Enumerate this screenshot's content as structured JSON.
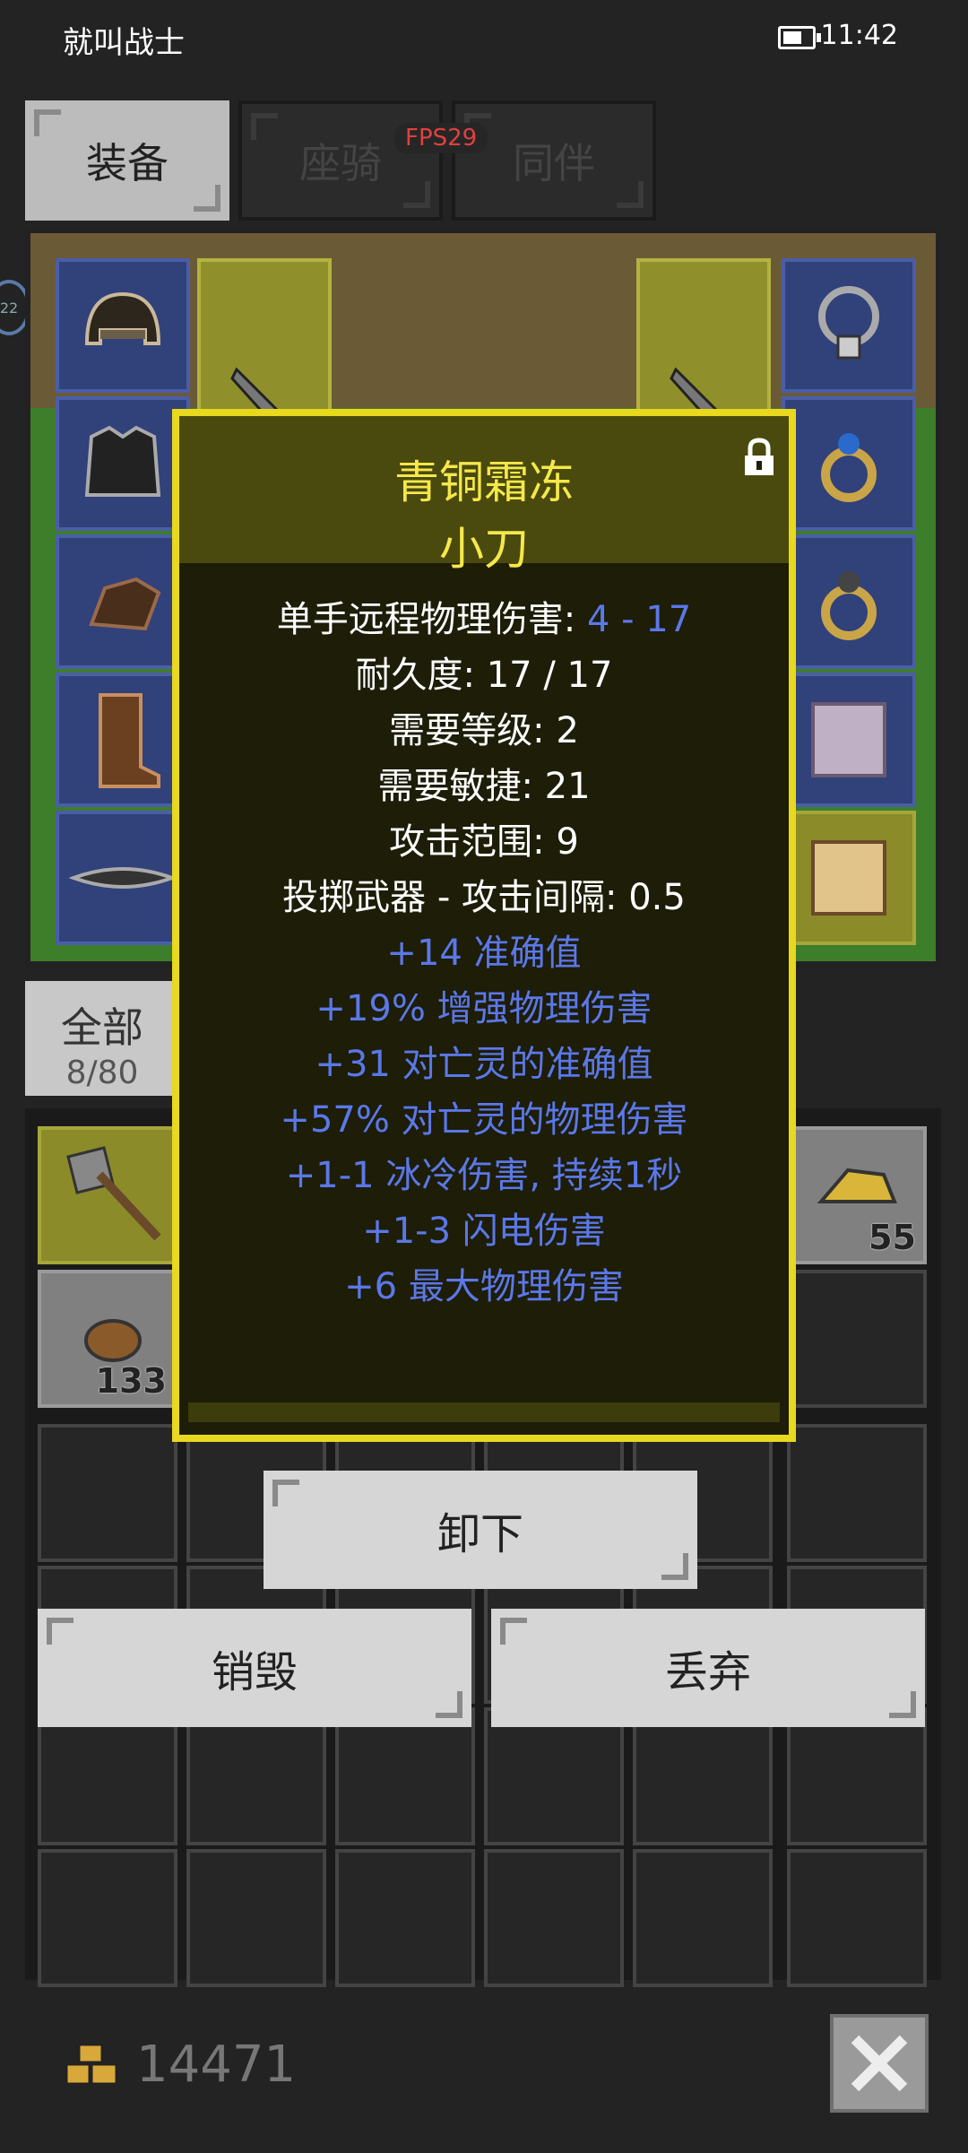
{
  "status_bar": {
    "title": "就叫战士",
    "time": "11:42"
  },
  "tabs": [
    {
      "label": "装备",
      "active": true
    },
    {
      "label": "座骑",
      "active": false
    },
    {
      "label": "同伴",
      "active": false
    }
  ],
  "fps": "FPS29",
  "side_badge": "22",
  "inventory": {
    "filter_label": "全部",
    "capacity": "8/80",
    "stack_counts": {
      "gold_nugget": "55",
      "meat": "133"
    }
  },
  "tooltip": {
    "name_line1": "青铜霜冻",
    "name_line2": "小刀",
    "stats": [
      {
        "text": "单手远程物理伤害: ",
        "value": "4 - 17"
      },
      {
        "text": "耐久度: 17 / 17"
      },
      {
        "text": "需要等级: 2"
      },
      {
        "text": "需要敏捷: 21"
      },
      {
        "text": "攻击范围: 9"
      },
      {
        "text": "投掷武器 - 攻击间隔: 0.5"
      }
    ],
    "bonuses": [
      "+14 准确值",
      "+19% 增强物理伤害",
      "+31 对亡灵的准确值",
      "+57% 对亡灵的物理伤害",
      "+1-1 冰冷伤害, 持续1秒",
      "+1-3 闪电伤害",
      "+6 最大物理伤害"
    ]
  },
  "actions": {
    "unequip": "卸下",
    "destroy": "销毁",
    "drop": "丢弃"
  },
  "gold": "14471",
  "colors": {
    "tooltip_border": "#e8d81e",
    "title_yellow": "#f5e84a",
    "bonus_blue": "#5b78e8",
    "panel_bg": "#232323"
  },
  "icons": [
    "battery-icon",
    "lock-icon",
    "gold-icon",
    "close-icon",
    "helmet-icon",
    "armor-icon",
    "glove-icon",
    "boots-icon",
    "belt-icon",
    "amulet-icon",
    "ring-icon",
    "axe-icon",
    "knife-icon"
  ]
}
